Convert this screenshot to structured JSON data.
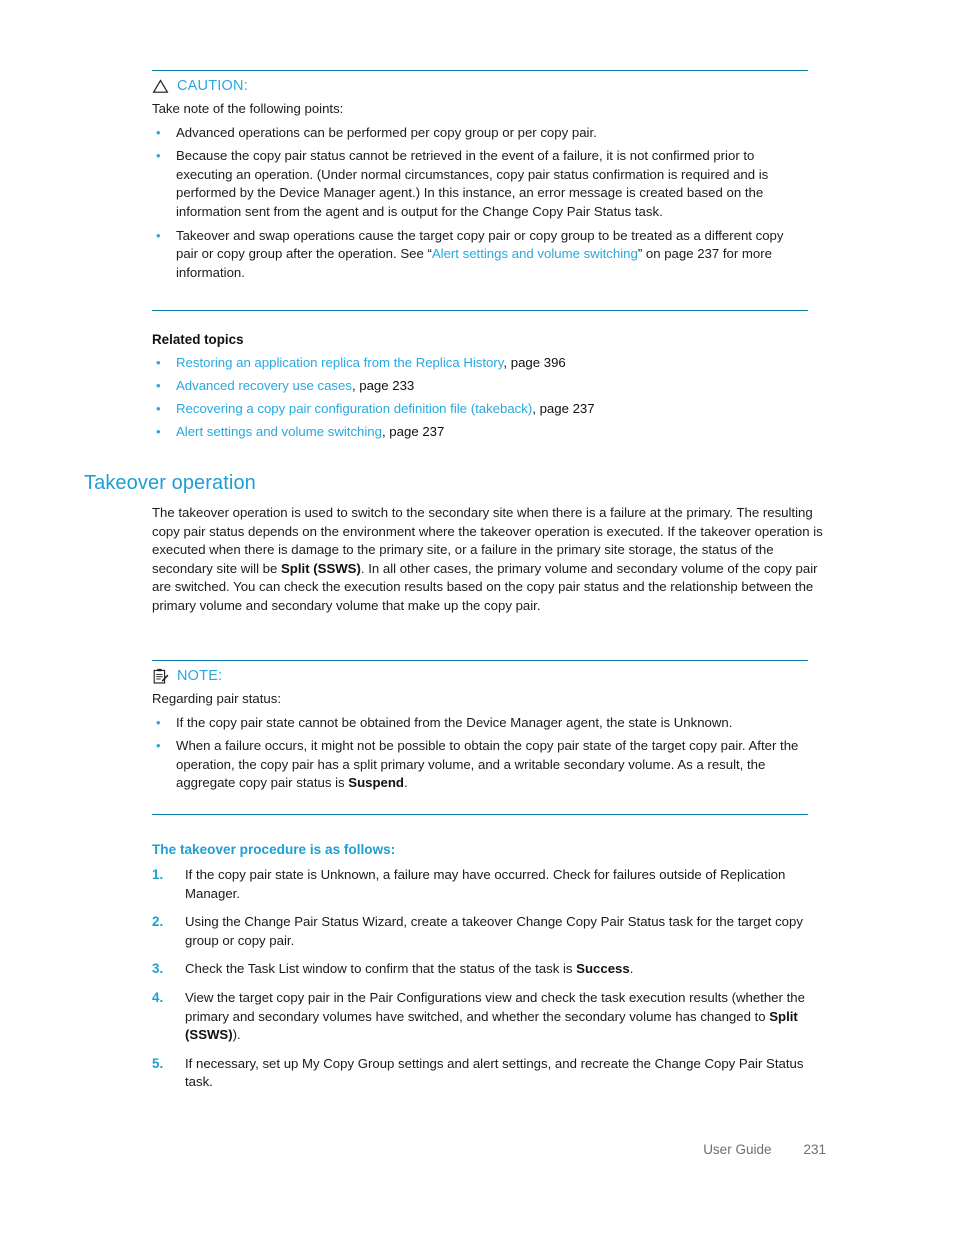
{
  "document": {
    "footer_label": "User Guide",
    "page_number": "231"
  },
  "colors": {
    "link": "#29a8df",
    "heading": "#1f9ed4",
    "rule": "#0b7bab",
    "body_text": "#1c1c1c",
    "footer_text": "#6f6f6f"
  },
  "caution": {
    "icon": "warning-triangle-icon",
    "title": "CAUTION:",
    "intro": "Take note of the following points:",
    "items": [
      {
        "pre": "Advanced operations can be performed per copy group or per copy pair.",
        "link": "",
        "post": ""
      },
      {
        "pre": "Because the copy pair status cannot be retrieved in the event of a failure, it is not confirmed prior to executing an operation. (Under normal circumstances, copy pair status confirmation is required and is performed by the Device Manager agent.) In this instance, an error message is created based on the information sent from the agent and is output for the Change Copy Pair Status task.",
        "link": "",
        "post": ""
      },
      {
        "pre": "Takeover and swap operations cause the target copy pair or copy group to be treated as a different copy pair or copy group after the operation. See “",
        "link": "Alert settings and volume switching",
        "post": "” on page 237 for more information."
      }
    ]
  },
  "related_topics": {
    "heading": "Related topics",
    "items": [
      {
        "link": "Restoring an application replica from the Replica History",
        "pageref": ", page 396"
      },
      {
        "link": "Advanced recovery use cases",
        "pageref": ", page 233"
      },
      {
        "link": "Recovering a copy pair configuration definition file (takeback)",
        "pageref": ", page 237"
      },
      {
        "link": "Alert settings and volume switching",
        "pageref": ", page 237"
      }
    ]
  },
  "takeover_section": {
    "heading": "Takeover operation",
    "paragraph_part1": "The takeover operation is used to switch to the secondary site when there is a failure at the primary. The resulting copy pair status depends on the environment where the takeover operation is executed. If the takeover operation is executed when there is damage to the primary site, or a failure in the primary site storage, the status of the secondary site will be ",
    "paragraph_bold": "Split (SSWS)",
    "paragraph_part2": ". In all other cases, the primary volume and secondary volume of the copy pair are switched. You can check the execution results based on the copy pair status and the relationship between the primary volume and secondary volume that make up the copy pair."
  },
  "note": {
    "icon": "note-clipboard-icon",
    "title": "NOTE:",
    "intro": "Regarding pair status:",
    "items": [
      {
        "pre": "If the copy pair state cannot be obtained from the Device Manager agent, the state is Unknown.",
        "bold": "",
        "post": ""
      },
      {
        "pre": "When a failure occurs, it might not be possible to obtain the copy pair state of the target copy pair. After the operation, the copy pair has a split primary volume, and a writable secondary volume. As a result, the aggregate copy pair status is ",
        "bold": "Suspend",
        "post": "."
      }
    ]
  },
  "procedure": {
    "heading": "The takeover procedure is as follows:",
    "steps": [
      {
        "number": "1.",
        "pre": "If the copy pair state is Unknown, a failure may have occurred. Check for failures outside of Replication Manager.",
        "bold": "",
        "post": ""
      },
      {
        "number": "2.",
        "pre": "Using the Change Pair Status Wizard, create a takeover Change Copy Pair Status task for the target copy group or copy pair.",
        "bold": "",
        "post": ""
      },
      {
        "number": "3.",
        "pre": "Check the Task List window to confirm that the status of the task is ",
        "bold": "Success",
        "post": "."
      },
      {
        "number": "4.",
        "pre": "View the target copy pair in the Pair Configurations view and check the task execution results (whether the primary and secondary volumes have switched, and whether the secondary volume has changed to ",
        "bold": "Split (SSWS)",
        "post": ")."
      },
      {
        "number": "5.",
        "pre": "If necessary, set up My Copy Group settings and alert settings, and recreate the Change Copy Pair Status task.",
        "bold": "",
        "post": ""
      }
    ]
  }
}
